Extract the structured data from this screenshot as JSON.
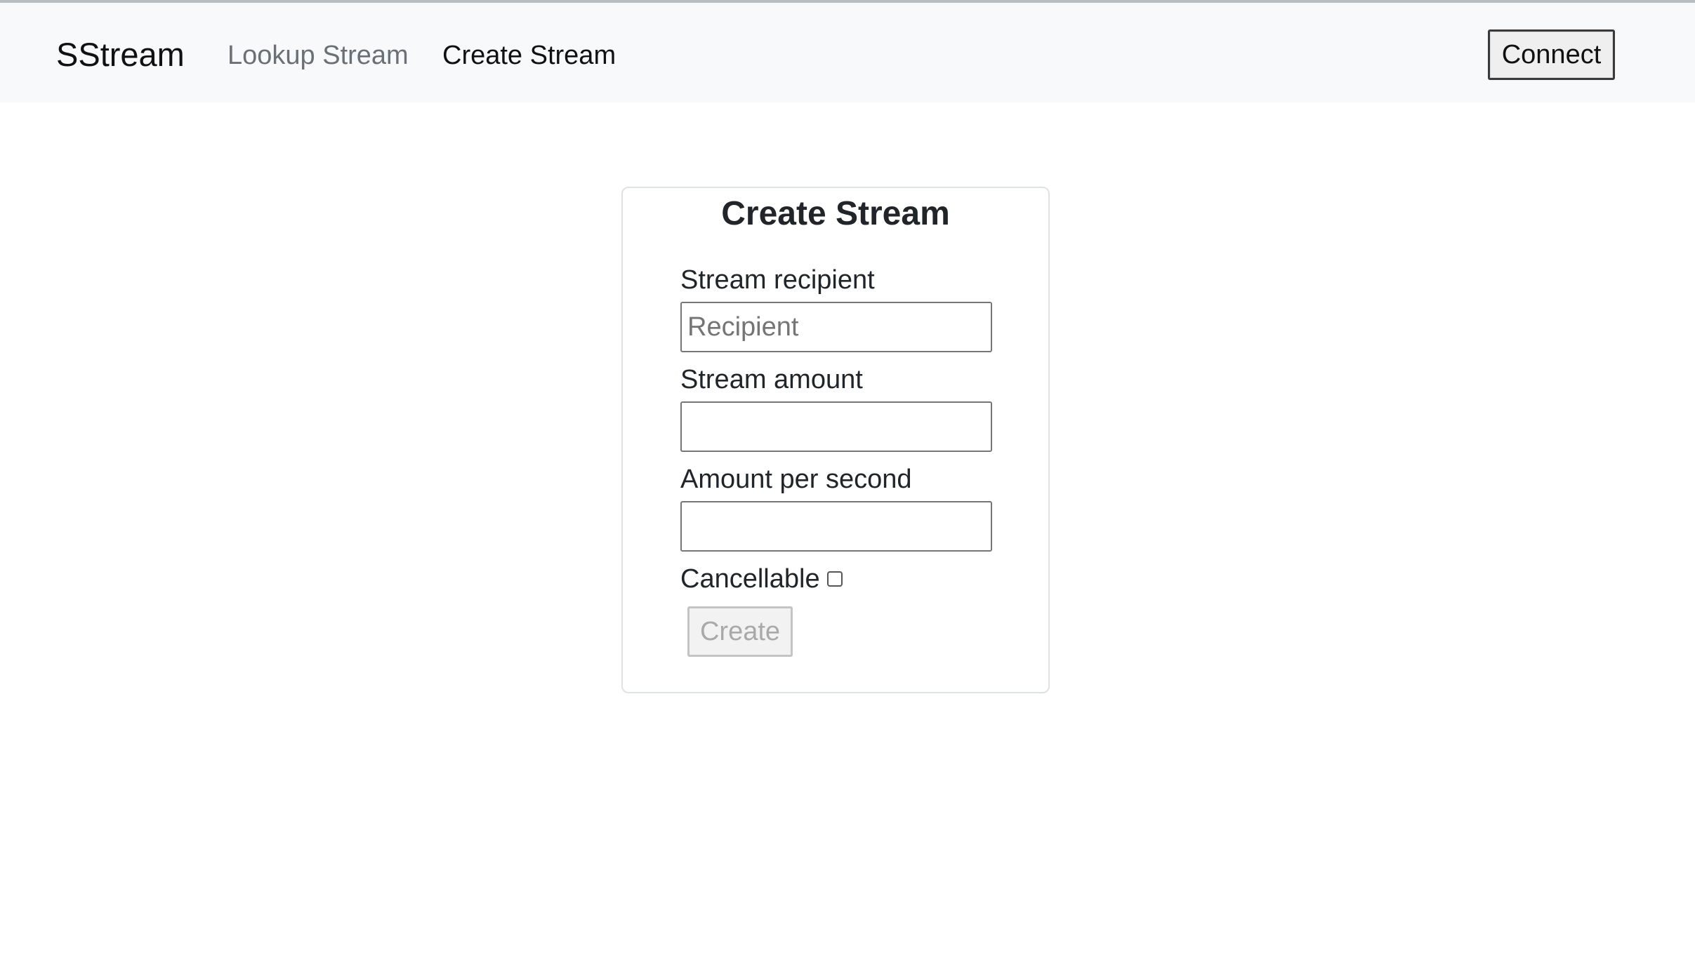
{
  "navbar": {
    "brand": "SStream",
    "links": [
      "Lookup Stream",
      "Create Stream"
    ],
    "connect_label": "Connect"
  },
  "form": {
    "title": "Create Stream",
    "recipient_label": "Stream recipient",
    "recipient_placeholder": "Recipient",
    "recipient_value": "",
    "amount_label": "Stream amount",
    "amount_value": "",
    "rate_label": "Amount per second",
    "rate_value": "",
    "cancellable_label": "Cancellable",
    "cancellable_checked": false,
    "create_label": "Create",
    "create_disabled": true
  },
  "colors": {
    "navbar_bg": "#f8f9fa",
    "text": "#212529",
    "muted_link": "#6c6f73",
    "card_border": "#dee2e6",
    "disabled_text": "#a9a9a9"
  }
}
